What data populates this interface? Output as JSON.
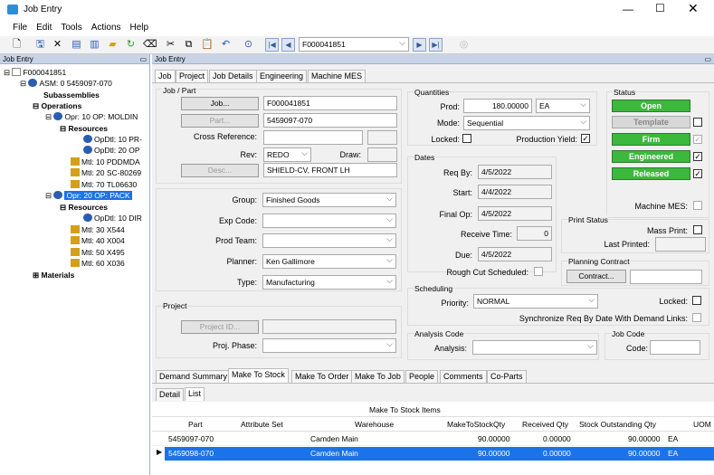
{
  "window": {
    "title": "Job Entry"
  },
  "menu": [
    "File",
    "Edit",
    "Tools",
    "Actions",
    "Help"
  ],
  "toolbar": {
    "job_search_value": "F000041851"
  },
  "tree": {
    "header": "Job Entry",
    "nodes": [
      {
        "text": "F000041851"
      },
      {
        "text": "ASM: 0 5459097-070"
      },
      {
        "text": "Subassemblies"
      },
      {
        "text": "Operations"
      },
      {
        "text": "Opr: 10 OP: MOLDIN"
      },
      {
        "text": "Resources"
      },
      {
        "text": "OpDtl: 10 PR-"
      },
      {
        "text": "OpDtl: 20 OP"
      },
      {
        "text": "Mtl: 10 PDDMDA"
      },
      {
        "text": "Mtl: 20 SC-80269"
      },
      {
        "text": "Mtl: 70 TL06630"
      },
      {
        "text": "Opr: 20 OP: PACK"
      },
      {
        "text": "Resources"
      },
      {
        "text": "OpDtl: 10 DIR"
      },
      {
        "text": "Mtl: 30 X544"
      },
      {
        "text": "Mtl: 40 X004"
      },
      {
        "text": "Mtl: 50 X495"
      },
      {
        "text": "Mtl: 60 X036"
      },
      {
        "text": "Materials"
      }
    ]
  },
  "right_header": "Job Entry",
  "tabs": [
    "Job",
    "Project",
    "Job Details",
    "Engineering",
    "Machine MES"
  ],
  "job_part": {
    "title": "Job / Part",
    "job_button": "Job...",
    "job_value": "F000041851",
    "part_button": "Part...",
    "part_value": "5459097-070",
    "crossref_label": "Cross Reference:",
    "rev_label": "Rev:",
    "rev_value": "REDO",
    "draw_label": "Draw:",
    "desc_button": "Desc...",
    "desc_value": "SHIELD-CV, FRONT LH"
  },
  "group_box": {
    "group_label": "Group:",
    "group_value": "Finished Goods",
    "expcode_label": "Exp Code:",
    "expcode_value": "",
    "prodteam_label": "Prod Team:",
    "prodteam_value": "",
    "planner_label": "Planner:",
    "planner_value": "Ken Gallimore",
    "type_label": "Type:",
    "type_value": "Manufacturing"
  },
  "project": {
    "title": "Project",
    "project_id_button": "Project ID...",
    "phase_label": "Proj. Phase:"
  },
  "quantities": {
    "title": "Quantities",
    "prod_label": "Prod:",
    "prod_value": "180.00000",
    "uom_value": "EA",
    "mode_label": "Mode:",
    "mode_value": "Sequential",
    "locked_label": "Locked:",
    "prod_yield_label": "Production Yield:"
  },
  "dates": {
    "title": "Dates",
    "req_by_label": "Req By:",
    "req_by_value": "4/5/2022",
    "start_label": "Start:",
    "start_value": "4/4/2022",
    "final_op_label": "Final Op:",
    "final_op_value": "4/5/2022",
    "receive_time_label": "Receive Time:",
    "receive_time_value": "0",
    "due_label": "Due:",
    "due_value": "4/5/2022",
    "rough_cut_label": "Rough Cut Scheduled:"
  },
  "scheduling": {
    "title": "Scheduling",
    "priority_label": "Priority:",
    "priority_value": "NORMAL",
    "locked_label": "Locked:",
    "sync_label": "Synchronize Req By Date With Demand Links:"
  },
  "analysis": {
    "title": "Analysis Code",
    "analysis_label": "Analysis:"
  },
  "job_code": {
    "title": "Job Code",
    "code_label": "Code:"
  },
  "status": {
    "title": "Status",
    "open": "Open",
    "template": "Template",
    "firm": "Firm",
    "engineered": "Engineered",
    "released": "Released",
    "machine_mes_label": "Machine MES:"
  },
  "print_status": {
    "title": "Print Status",
    "mass_print_label": "Mass Print:",
    "last_printed_label": "Last Printed:"
  },
  "planning_contract": {
    "title": "Planning Contract",
    "contract_button": "Contract..."
  },
  "bottom_tabs": [
    "Demand Summary",
    "Make To Stock",
    "Make To Order",
    "Make To Job",
    "People",
    "Comments",
    "Co-Parts"
  ],
  "sub_tabs": [
    "Detail",
    "List"
  ],
  "grid": {
    "caption": "Make To Stock Items",
    "columns": [
      "Part",
      "Attribute Set",
      "Warehouse",
      "MakeToStockQty",
      "Received Qty",
      "Stock Outstanding Qty",
      "UOM"
    ],
    "rows": [
      [
        "5459097-070",
        "",
        "Camden Main",
        "90.00000",
        "0.00000",
        "90.00000",
        "EA"
      ],
      [
        "5459098-070",
        "",
        "Camden Main",
        "90.00000",
        "0.00000",
        "90.00000",
        "EA"
      ]
    ]
  },
  "colors": {
    "status_green": "#3cb83c",
    "selection_blue": "#1a73e8",
    "panel_header": "#c8d4e6"
  }
}
